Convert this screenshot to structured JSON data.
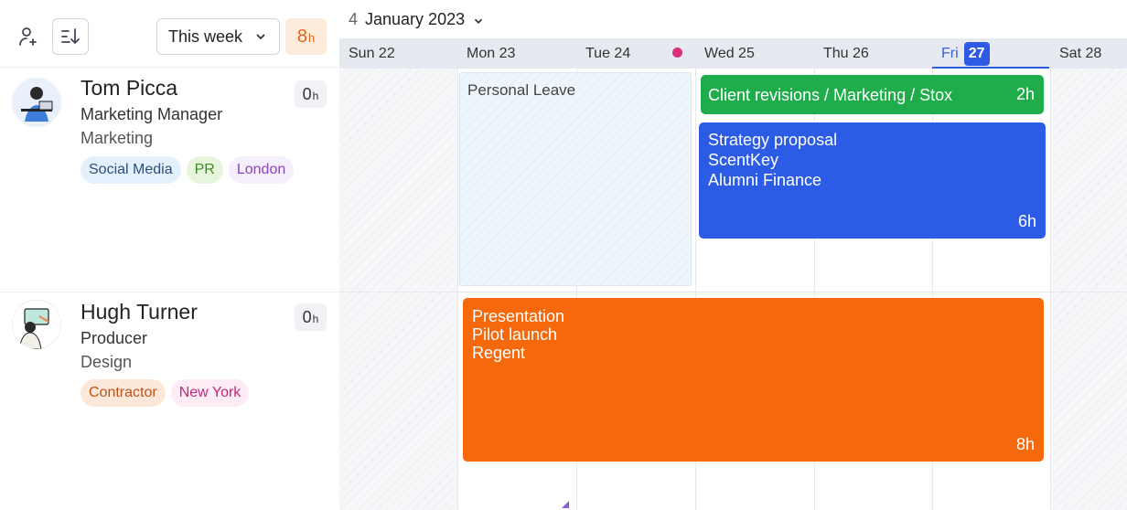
{
  "toolbar": {
    "week_select": "This week",
    "total_hours_value": "8",
    "total_hours_unit": "h"
  },
  "calendar": {
    "back_count": "4",
    "month_label": "January 2023",
    "days": [
      {
        "label": "Sun 22"
      },
      {
        "label": "Mon 23"
      },
      {
        "label": "Tue 24"
      },
      {
        "label": "Wed 25"
      },
      {
        "label": "Thu 26"
      },
      {
        "label": "Fri",
        "badge": "27"
      },
      {
        "label": "Sat 28"
      }
    ]
  },
  "people": [
    {
      "name": "Tom Picca",
      "role": "Marketing Manager",
      "department": "Marketing",
      "hours_value": "0",
      "hours_unit": "h",
      "tags": [
        "Social Media",
        "PR",
        "London"
      ]
    },
    {
      "name": "Hugh Turner",
      "role": "Producer",
      "department": "Design",
      "hours_value": "0",
      "hours_unit": "h",
      "tags": [
        "Contractor",
        "New York"
      ]
    }
  ],
  "events": {
    "leave": "Personal Leave",
    "client_revisions": {
      "title": "Client revisions / Marketing / Stox",
      "hours": "2h"
    },
    "strategy": {
      "title": "Strategy proposal",
      "line2": "ScentKey",
      "line3": "Alumni Finance",
      "hours": "6h"
    },
    "presentation": {
      "title": "Presentation",
      "line2": "Pilot launch",
      "line3": "Regent",
      "hours": "8h"
    }
  },
  "colors": {
    "accent_blue": "#2c5be6",
    "green_task": "#1fac4b",
    "orange_task": "#f5690c",
    "holiday_dot": "#d9307d"
  },
  "icons": [
    "add-person-icon",
    "sort-icon",
    "chevron-down-icon"
  ]
}
